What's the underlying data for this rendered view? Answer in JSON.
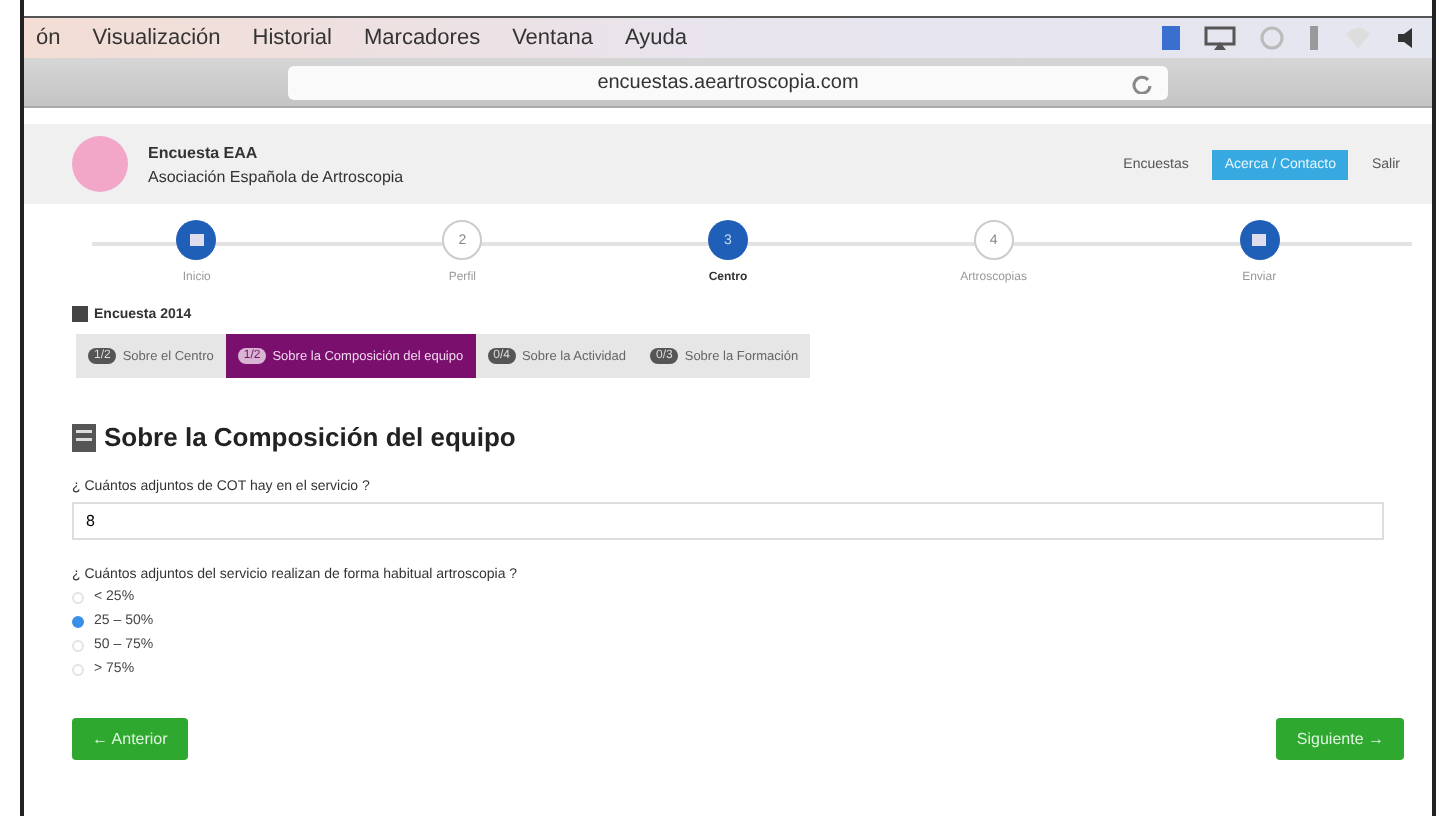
{
  "menu_bar": {
    "items": [
      "ón",
      "Visualización",
      "Historial",
      "Marcadores",
      "Ventana",
      "Ayuda"
    ]
  },
  "address_bar": {
    "url": "encuestas.aeartroscopia.com"
  },
  "header": {
    "title": "Encuesta EAA",
    "subtitle": "Asociación Española de Artroscopia",
    "nav": [
      {
        "label": "Encuestas",
        "selected": false
      },
      {
        "label": "Acerca / Contacto",
        "selected": true
      },
      {
        "label": "Salir",
        "selected": false
      }
    ]
  },
  "steps": [
    {
      "label": "Inicio",
      "completed": true,
      "selected": false
    },
    {
      "label": "Perfil",
      "number": "2",
      "completed": false,
      "selected": false
    },
    {
      "label": "Centro",
      "number": "3",
      "completed": false,
      "selected": true
    },
    {
      "label": "Artroscopias",
      "number": "4",
      "completed": false,
      "selected": false
    },
    {
      "label": "Enviar",
      "completed": true,
      "selected": false
    }
  ],
  "breadcrumb": "Encuesta 2014",
  "tabs": [
    {
      "badge": "1/2",
      "label": "Sobre el Centro",
      "selected": false
    },
    {
      "badge": "1/2",
      "label": "Sobre la Composición del equipo",
      "selected": true
    },
    {
      "badge": "0/4",
      "label": "Sobre la Actividad",
      "selected": false
    },
    {
      "badge": "0/3",
      "label": "Sobre la Formación",
      "selected": false
    }
  ],
  "section_title": "Sobre la Composición del equipo",
  "questions": [
    {
      "kind": "text",
      "label": "¿ Cuántos adjuntos de COT hay en el servicio ?",
      "value": "8"
    },
    {
      "kind": "radio",
      "label": "¿ Cuántos adjuntos del servicio realizan de forma habitual artroscopia ?",
      "options": [
        {
          "label": "< 25%",
          "selected": false
        },
        {
          "label": "25 – 50%",
          "selected": true
        },
        {
          "label": "50 – 75%",
          "selected": false
        },
        {
          "label": "> 75%",
          "selected": false
        }
      ]
    }
  ],
  "buttons": {
    "back": "← Anterior",
    "next": "Siguiente →"
  }
}
